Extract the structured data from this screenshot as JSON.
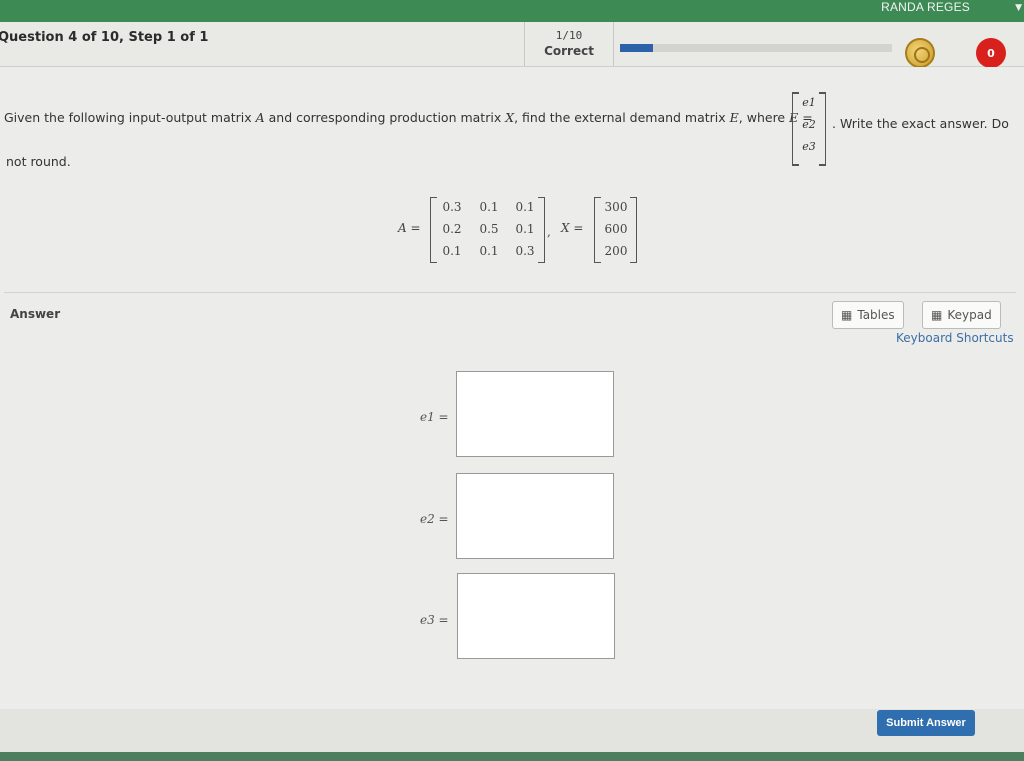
{
  "header": {
    "user_name": "RANDA REGES"
  },
  "question_bar": {
    "title": "Question 4 of 10, Step 1 of 1",
    "progress_count": "1/10",
    "progress_status": "Correct",
    "progress_fraction": 0.12,
    "notification_count": "0"
  },
  "question": {
    "text_part1_a": "Given the following input-output matrix ",
    "var_A": "A",
    "text_part1_b": " and corresponding production matrix ",
    "var_X": "X",
    "text_part1_c": ", find the external demand matrix ",
    "var_E": "E",
    "text_part1_d": ", where ",
    "var_E2": "E",
    "equals": " =",
    "vector": [
      "e1",
      "e2",
      "e3"
    ],
    "text_part2": ". Write the exact answer. Do",
    "text_part3": "not round."
  },
  "matrices": {
    "A_label": "A =",
    "A": [
      [
        "0.3",
        "0.1",
        "0.1"
      ],
      [
        "0.2",
        "0.5",
        "0.1"
      ],
      [
        "0.1",
        "0.1",
        "0.3"
      ]
    ],
    "X_label": "X =",
    "X": [
      "300",
      "600",
      "200"
    ],
    "sep": ","
  },
  "answer": {
    "label": "Answer",
    "tables_label": "Tables",
    "keypad_label": "Keypad",
    "shortcuts_label": "Keyboard Shortcuts",
    "rows": [
      {
        "label": "e1 =",
        "value": ""
      },
      {
        "label": "e2 =",
        "value": ""
      },
      {
        "label": "e3 =",
        "value": ""
      }
    ],
    "submit_label": "Submit Answer"
  },
  "colors": {
    "topbar": "#3d8a55",
    "accent": "#2f6fb0",
    "badge": "#d8201d"
  }
}
